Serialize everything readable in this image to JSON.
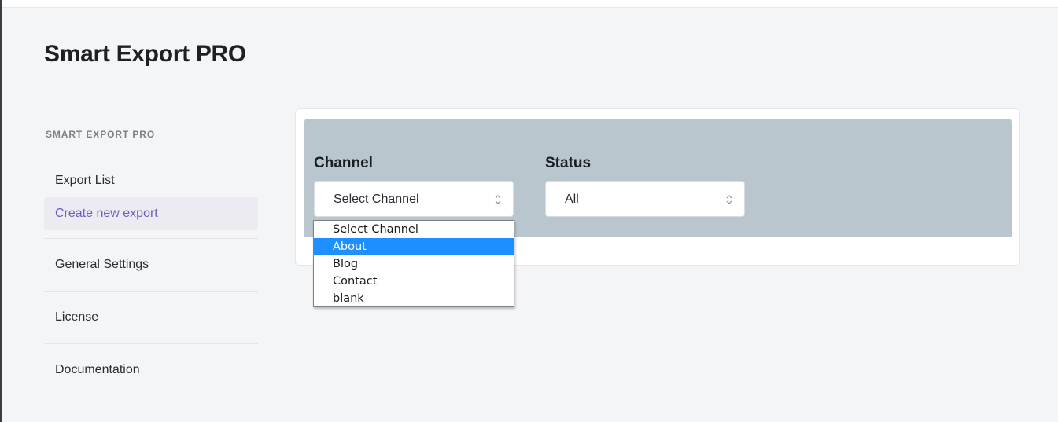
{
  "app": {
    "title": "Smart Export PRO"
  },
  "sidebar": {
    "heading": "SMART EXPORT PRO",
    "items": [
      {
        "label": "Export List",
        "active": false
      },
      {
        "label": "Create new export",
        "active": true
      },
      {
        "label": "General Settings",
        "active": false
      },
      {
        "label": "License",
        "active": false
      },
      {
        "label": "Documentation",
        "active": false
      }
    ]
  },
  "filters": {
    "channel": {
      "label": "Channel",
      "selected": "Select Channel",
      "options": [
        "Select Channel",
        "About",
        "Blog",
        "Contact",
        "blank"
      ],
      "highlighted": "About"
    },
    "status": {
      "label": "Status",
      "selected": "All"
    }
  },
  "colors": {
    "accent": "#6b5fc7",
    "filter_bar": "#b9c6ce",
    "highlight": "#1e8fff"
  }
}
